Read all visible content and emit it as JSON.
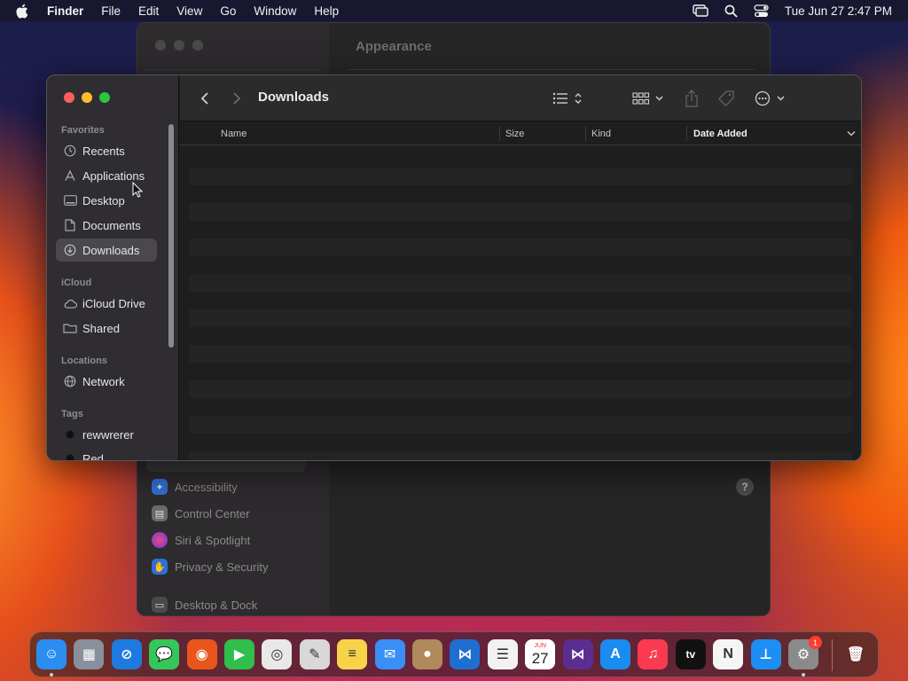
{
  "menubar": {
    "app_name": "Finder",
    "menus": [
      "File",
      "Edit",
      "View",
      "Go",
      "Window",
      "Help"
    ],
    "datetime": "Tue Jun 27  2:47 PM"
  },
  "settings_window": {
    "title": "Appearance",
    "sidebar_items": [
      {
        "label": "Accessibility",
        "icon": "accessibility-icon",
        "color": "#2f6fd6"
      },
      {
        "label": "Control Center",
        "icon": "control-center-icon",
        "color": "#6b6b6b"
      },
      {
        "label": "Siri & Spotlight",
        "icon": "siri-icon",
        "color": "#b0309a"
      },
      {
        "label": "Privacy & Security",
        "icon": "hand-icon",
        "color": "#2f6fd6"
      },
      {
        "label": "Desktop & Dock",
        "icon": "desktop-dock-icon",
        "color": "#4a4a4a"
      }
    ],
    "help_label": "?"
  },
  "finder": {
    "title": "Downloads",
    "sidebar": {
      "favorites_heading": "Favorites",
      "favorites": [
        {
          "label": "Recents",
          "icon": "clock-icon"
        },
        {
          "label": "Applications",
          "icon": "applications-icon"
        },
        {
          "label": "Desktop",
          "icon": "desktop-icon"
        },
        {
          "label": "Documents",
          "icon": "document-icon"
        },
        {
          "label": "Downloads",
          "icon": "download-icon",
          "selected": true
        }
      ],
      "icloud_heading": "iCloud",
      "icloud": [
        {
          "label": "iCloud Drive",
          "icon": "cloud-icon"
        },
        {
          "label": "Shared",
          "icon": "shared-folder-icon"
        }
      ],
      "locations_heading": "Locations",
      "locations": [
        {
          "label": "Network",
          "icon": "globe-icon"
        }
      ],
      "tags_heading": "Tags",
      "tags": [
        {
          "label": "rewwrerer",
          "color": "#111111"
        },
        {
          "label": "Red",
          "color": "#111111"
        }
      ]
    },
    "columns": [
      "Name",
      "Size",
      "Kind",
      "Date Added"
    ],
    "sorted_column": "Date Added"
  },
  "dock": {
    "apps": [
      {
        "name": "Finder",
        "icon": "finder-icon",
        "color": "#2a8ef0",
        "glyph": "☺",
        "running": true
      },
      {
        "name": "Launchpad",
        "icon": "launchpad-icon",
        "color": "#8a8f9c",
        "glyph": "▦"
      },
      {
        "name": "Safari",
        "icon": "safari-icon",
        "color": "#1f7ae0",
        "glyph": "⊘"
      },
      {
        "name": "Messages",
        "icon": "messages-icon",
        "color": "#34c759",
        "glyph": "💬"
      },
      {
        "name": "Firefox",
        "icon": "firefox-icon",
        "color": "#e8561c",
        "glyph": "◉"
      },
      {
        "name": "FaceTime",
        "icon": "facetime-icon",
        "color": "#2fbf4a",
        "glyph": "▶"
      },
      {
        "name": "Chrome",
        "icon": "chrome-icon",
        "color": "#e8e8e8",
        "glyph": "◎"
      },
      {
        "name": "Script Editor",
        "icon": "script-editor-icon",
        "color": "#d8d8d8",
        "glyph": "✎"
      },
      {
        "name": "Notes",
        "icon": "notes-icon",
        "color": "#f7d34a",
        "glyph": "≡"
      },
      {
        "name": "Mail",
        "icon": "mail-icon",
        "color": "#3a8ef5",
        "glyph": "✉"
      },
      {
        "name": "Contacts",
        "icon": "contacts-icon",
        "color": "#b08a5a",
        "glyph": "●"
      },
      {
        "name": "VS Code",
        "icon": "vscode-icon",
        "color": "#1e6fd0",
        "glyph": "⋈"
      },
      {
        "name": "Reminders",
        "icon": "reminders-icon",
        "color": "#f2f2f2",
        "glyph": "☰"
      },
      {
        "name": "Calendar",
        "icon": "calendar-icon",
        "color": "#ffffff",
        "glyph": "27",
        "month": "JUN"
      },
      {
        "name": "Visual Studio",
        "icon": "visual-studio-icon",
        "color": "#5c2d91",
        "glyph": "⋈"
      },
      {
        "name": "App Store",
        "icon": "app-store-icon",
        "color": "#1a8cf0",
        "glyph": "A"
      },
      {
        "name": "Music",
        "icon": "music-icon",
        "color": "#fa3a50",
        "glyph": "♫"
      },
      {
        "name": "TV",
        "icon": "tv-icon",
        "color": "#111111",
        "glyph": "tv"
      },
      {
        "name": "News",
        "icon": "news-icon",
        "color": "#f5f5f5",
        "glyph": "N"
      },
      {
        "name": "Keynote",
        "icon": "keynote-icon",
        "color": "#1d8ef2",
        "glyph": "⊥"
      },
      {
        "name": "System Settings",
        "icon": "settings-icon",
        "color": "#8a8a8a",
        "glyph": "⚙",
        "running": true,
        "badge": "1"
      },
      {
        "name": "Trash",
        "icon": "trash-icon",
        "color": "transparent",
        "glyph": "🗑"
      }
    ]
  }
}
